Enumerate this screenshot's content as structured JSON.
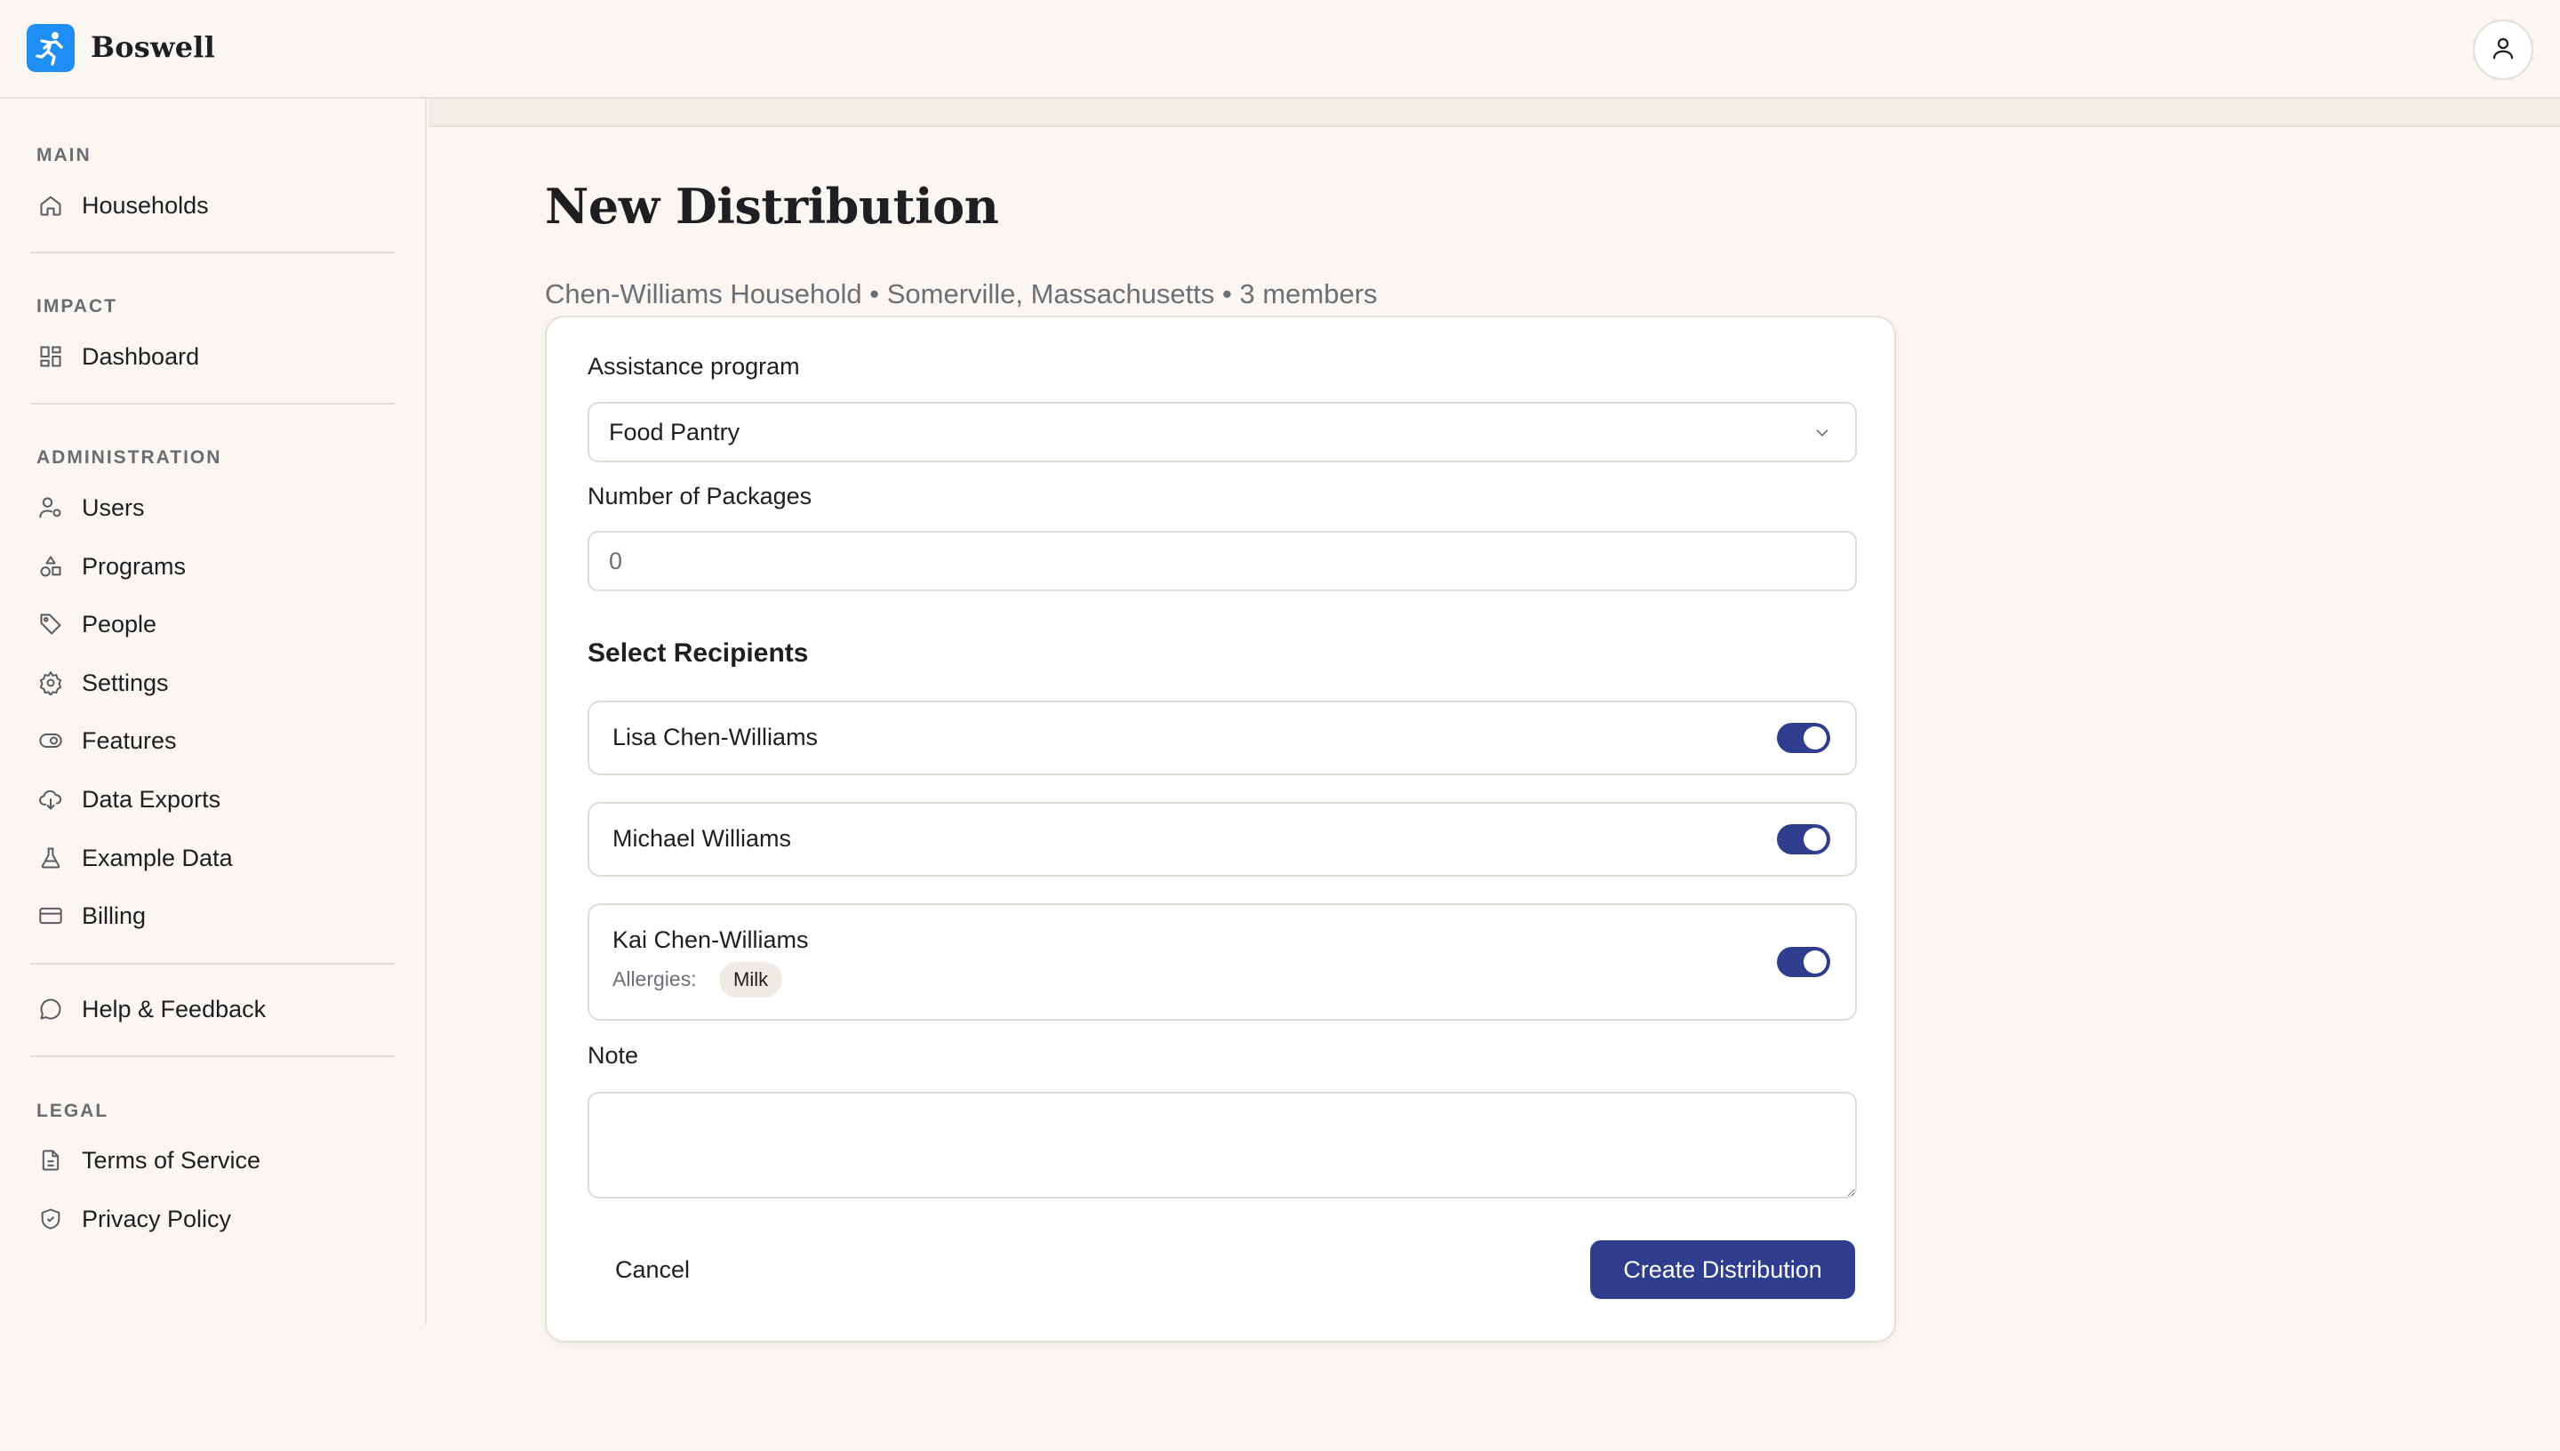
{
  "app": {
    "name": "Boswell"
  },
  "sidebar": {
    "sections": {
      "main": "MAIN",
      "impact": "IMPACT",
      "administration": "ADMINISTRATION",
      "legal": "LEGAL"
    },
    "items": {
      "households": "Households",
      "dashboard": "Dashboard",
      "users": "Users",
      "programs": "Programs",
      "people": "People",
      "settings": "Settings",
      "features": "Features",
      "data_exports": "Data Exports",
      "example_data": "Example Data",
      "billing": "Billing",
      "help": "Help & Feedback",
      "terms": "Terms of Service",
      "privacy": "Privacy Policy"
    }
  },
  "page": {
    "title": "New Distribution",
    "subtitle": "Chen-Williams Household • Somerville, Massachusetts • 3 members"
  },
  "form": {
    "program_label": "Assistance program",
    "program_value": "Food Pantry",
    "packages_label": "Number of Packages",
    "packages_placeholder": "0",
    "recipients_heading": "Select Recipients",
    "recipients": [
      {
        "name": "Lisa Chen-Williams",
        "selected": true
      },
      {
        "name": "Michael Williams",
        "selected": true
      },
      {
        "name": "Kai Chen-Williams",
        "selected": true,
        "allergies_label": "Allergies:",
        "allergy": "Milk"
      }
    ],
    "note_label": "Note",
    "cancel_label": "Cancel",
    "submit_label": "Create Distribution"
  },
  "colors": {
    "accent": "#2f3d8f",
    "logo": "#1e8ef4",
    "background": "#faf7f2"
  },
  "icons": {
    "logo": "runner-logo-icon",
    "user": "user-icon",
    "households": "home-icon",
    "dashboard": "dashboard-grid-icon",
    "users": "user-cog-icon",
    "programs": "shapes-icon",
    "people": "tag-icon",
    "settings": "gear-icon",
    "features": "toggle-icon",
    "data_exports": "cloud-download-icon",
    "example_data": "flask-icon",
    "billing": "credit-card-icon",
    "help": "chat-bubble-icon",
    "terms": "document-icon",
    "privacy": "shield-check-icon"
  }
}
